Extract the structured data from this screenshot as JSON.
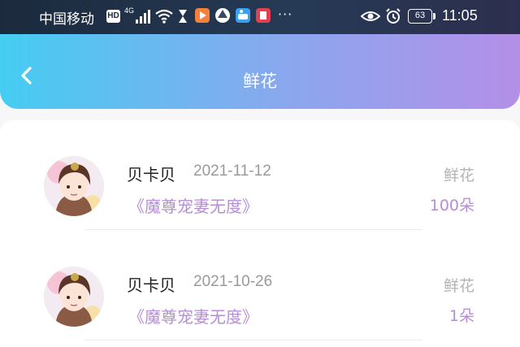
{
  "status_bar": {
    "carrier": "中国移动",
    "hd_badge": "HD",
    "network": "4G",
    "battery": "63",
    "time": "11:05",
    "more": "···",
    "icons": [
      "signal-icon",
      "wifi-icon",
      "hourglass-icon",
      "video-app-icon",
      "browser-app-icon",
      "game-app-icon",
      "book-app-icon",
      "eye-icon",
      "alarm-icon",
      "battery-icon"
    ]
  },
  "header": {
    "title": "鲜花",
    "back_icon": "chevron-left-icon",
    "gradient": [
      "#45cdf2",
      "#b48fe8"
    ]
  },
  "records": [
    {
      "user": "贝卡贝",
      "date": "2021-11-12",
      "book": "《魔尊宠妻无度》",
      "gift_label": "鲜花",
      "gift_count": "100朵"
    },
    {
      "user": "贝卡贝",
      "date": "2021-10-26",
      "book": "《魔尊宠妻无度》",
      "gift_label": "鲜花",
      "gift_count": "1朵"
    }
  ],
  "colors": {
    "accent": "#b58ed6",
    "muted": "#999999"
  }
}
